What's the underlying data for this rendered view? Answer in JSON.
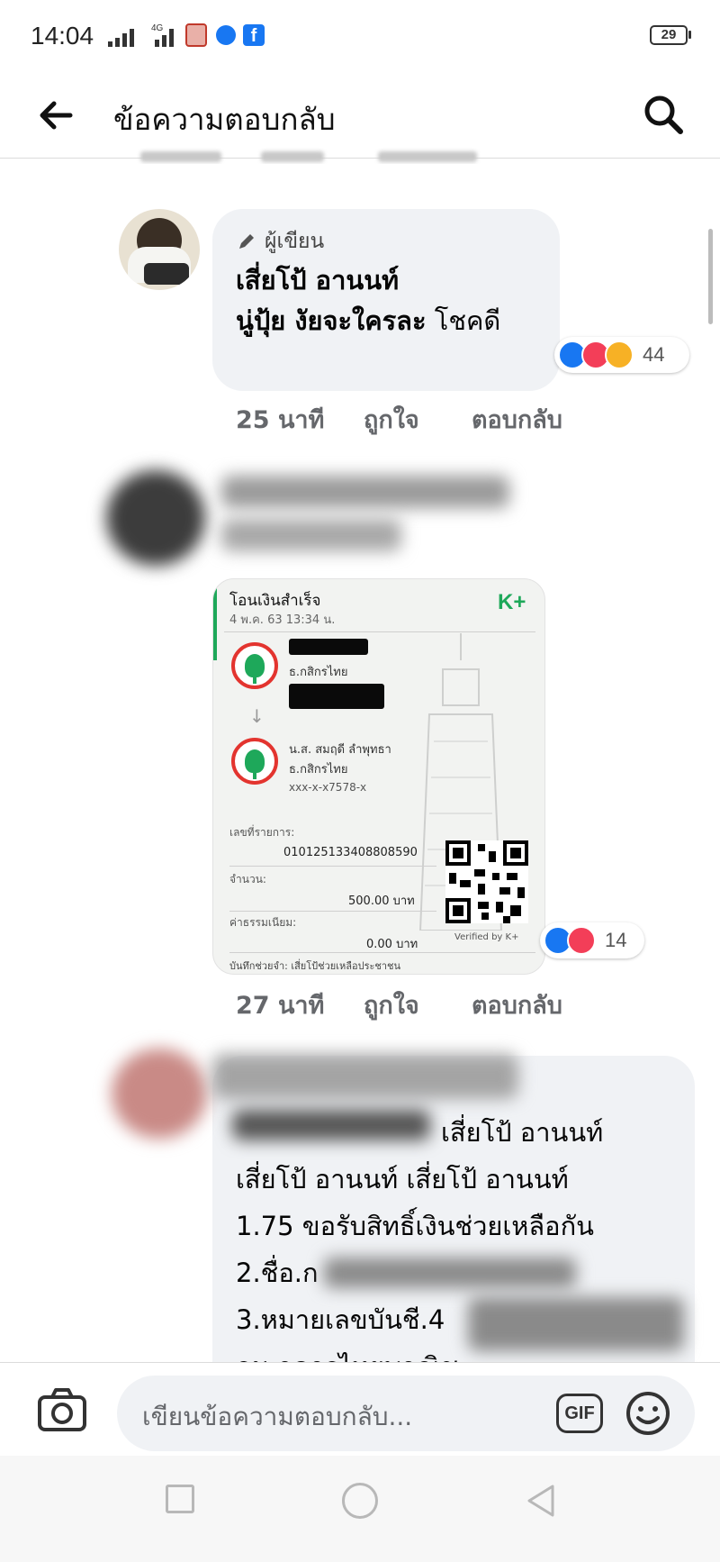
{
  "status_bar": {
    "time": "14:04",
    "network_label": "4G",
    "battery": "29"
  },
  "header": {
    "title": "ข้อความตอบกลับ",
    "back_icon": "arrow-left-icon",
    "search_icon": "search-icon"
  },
  "comments": [
    {
      "author_badge": "ผู้เขียน",
      "name": "เสี่ยโป้ อานนท์",
      "text_bold": "นู่ปุ้ย งัยจะใครละ",
      "text_rest": "โชคดี",
      "reaction_icons": [
        "like-icon",
        "love-icon",
        "care-icon"
      ],
      "reaction_count": "44",
      "time": "25 นาที",
      "like_label": "ถูกใจ",
      "reply_label": "ตอบกลับ"
    },
    {
      "receipt": {
        "title": "โอนเงินสำเร็จ",
        "date": "4 พ.ค. 63  13:34 น.",
        "logo": "K+",
        "from_bank": "ธ.กสิกรไทย",
        "to_name": "น.ส. สมฤดี ลำพุทธา",
        "to_bank": "ธ.กสิกรไทย",
        "to_account": "xxx-x-x7578-x",
        "ref_label": "เลขที่รายการ:",
        "ref_value": "010125133408808590",
        "amount_label": "จำนวน:",
        "amount_value": "500.00 บาท",
        "fee_label": "ค่าธรรมเนียม:",
        "fee_value": "0.00 บาท",
        "verified": "Verified by K+",
        "memo": "บันทึกช่วยจำ: เสี่ยโป้ช่วยเหลือประชาชน"
      },
      "reaction_icons": [
        "like-icon",
        "love-icon"
      ],
      "reaction_count": "14",
      "time": "27 นาที",
      "like_label": "ถูกใจ",
      "reply_label": "ตอบกลับ"
    },
    {
      "line1_rest": "เสี่ยโป้ อานนท์",
      "line2": "เสี่ยโป้ อานนท์ เสี่ยโป้ อานนท์",
      "line3": "1.75 ขอรับสิทธิ์เงินช่วยเหลือกัน",
      "line4": "2.ชื่อ.ก",
      "line5": "3.หมายเลขบันชี.4",
      "line6": "ธน าคารไทยพาณิช"
    }
  ],
  "composer": {
    "placeholder": "เขียนข้อความตอบกลับ...",
    "camera_icon": "camera-icon",
    "gif_label": "GIF",
    "emoji_icon": "smiley-icon"
  },
  "navbar": {
    "icons": [
      "square-icon",
      "circle-icon",
      "back-triangle-icon"
    ]
  }
}
